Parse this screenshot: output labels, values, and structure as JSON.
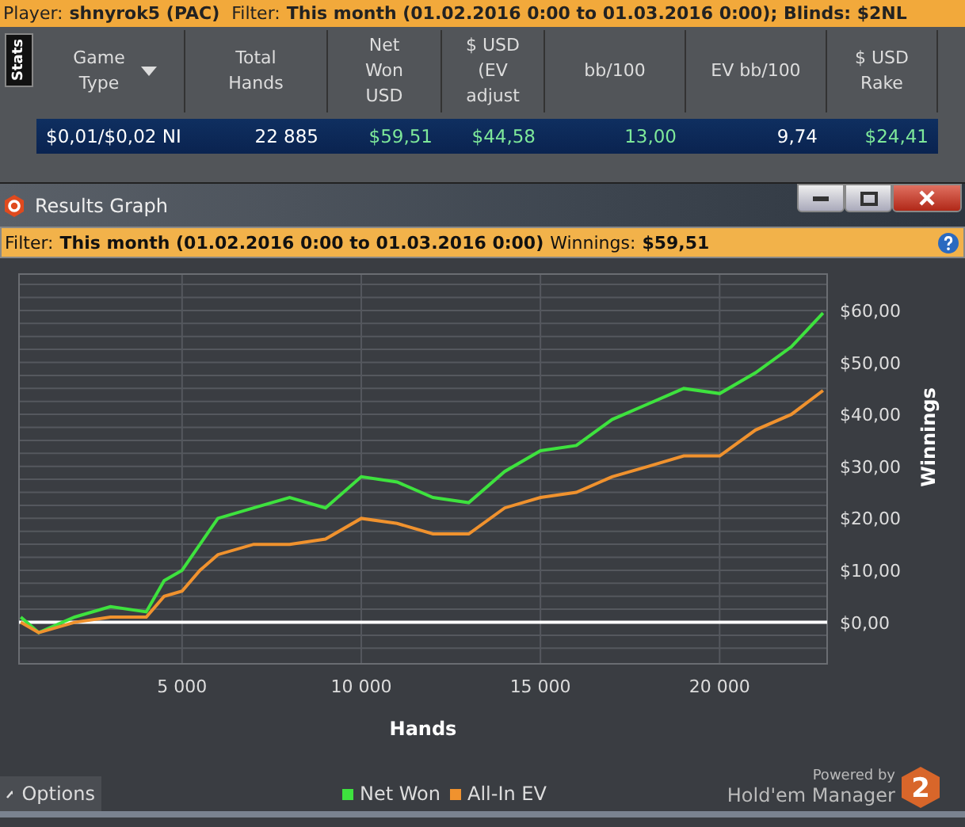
{
  "top_bar": {
    "player_label": "Player:",
    "player": "shnyrok5 (PAC)",
    "filter_label": "Filter:",
    "filter": "This month (01.02.2016 0:00 to 01.03.2016 0:00); Blinds: $2NL"
  },
  "stats_tab": {
    "label": "Stats"
  },
  "table": {
    "columns": [
      {
        "label": "Game Type",
        "dropdown": true
      },
      {
        "label": "Total Hands",
        "dropdown": false
      },
      {
        "label": "Net Won USD",
        "dropdown": false
      },
      {
        "label": "$ USD (EV adjust",
        "dropdown": false
      },
      {
        "label": "bb/100",
        "dropdown": false
      },
      {
        "label": "EV bb/100",
        "dropdown": false
      },
      {
        "label": "$ USD Rake",
        "dropdown": false
      }
    ],
    "rows": [
      {
        "selected": true,
        "cells": [
          {
            "text": "$0,01/$0,02 NI",
            "color": "#ffffff"
          },
          {
            "text": "22 885",
            "color": "#ffffff"
          },
          {
            "text": "$59,51",
            "color": "#7ee89a"
          },
          {
            "text": "$44,58",
            "color": "#7ee89a"
          },
          {
            "text": "13,00",
            "color": "#7ee89a"
          },
          {
            "text": "9,74",
            "color": "#ffffff"
          },
          {
            "text": "$24,41",
            "color": "#7ee89a"
          }
        ]
      }
    ]
  },
  "window": {
    "title": "Results Graph"
  },
  "filter_bar": {
    "filter_label": "Filter:",
    "filter": "This month (01.02.2016 0:00 to 01.03.2016 0:00)",
    "winnings_label": "Winnings:",
    "winnings": "$59,51"
  },
  "chart": {
    "chart_data": {
      "type": "line",
      "grid": true,
      "xlabel": "Hands",
      "ylabel": "Winnings",
      "xlim": [
        450,
        23000
      ],
      "ylim": [
        -8,
        67
      ],
      "xticks": [
        {
          "value": 5000,
          "label": "5 000"
        },
        {
          "value": 10000,
          "label": "10 000"
        },
        {
          "value": 15000,
          "label": "15 000"
        },
        {
          "value": 20000,
          "label": "20 000"
        }
      ],
      "yticks": [
        {
          "value": 0,
          "label": "$0,00"
        },
        {
          "value": 10,
          "label": "$10,00"
        },
        {
          "value": 20,
          "label": "$20,00"
        },
        {
          "value": 30,
          "label": "$30,00"
        },
        {
          "value": 40,
          "label": "$40,00"
        },
        {
          "value": 50,
          "label": "$50,00"
        },
        {
          "value": 60,
          "label": "$60,00"
        }
      ],
      "x": [
        500,
        1000,
        2000,
        3000,
        4000,
        4500,
        5000,
        5500,
        6000,
        7000,
        8000,
        9000,
        10000,
        11000,
        12000,
        13000,
        14000,
        15000,
        16000,
        17000,
        18000,
        19000,
        20000,
        21000,
        22000,
        22885
      ],
      "series": [
        {
          "name": "Net Won",
          "color": "#3ee23e",
          "values": [
            1,
            -2,
            1,
            3,
            2,
            8,
            10,
            15,
            20,
            22,
            24,
            22,
            28,
            27,
            24,
            23,
            29,
            33,
            34,
            39,
            42,
            45,
            44,
            48,
            53,
            59.5
          ]
        },
        {
          "name": "All-In EV",
          "color": "#f0922e",
          "values": [
            0,
            -2,
            0,
            1,
            1,
            5,
            6,
            10,
            13,
            15,
            15,
            16,
            20,
            19,
            17,
            17,
            22,
            24,
            25,
            28,
            30,
            32,
            32,
            37,
            40,
            44.6
          ]
        }
      ]
    }
  },
  "options_button": {
    "label": "Options"
  },
  "branding": {
    "powered_by": "Powered by",
    "product": "Hold'em Manager",
    "badge": "2"
  }
}
